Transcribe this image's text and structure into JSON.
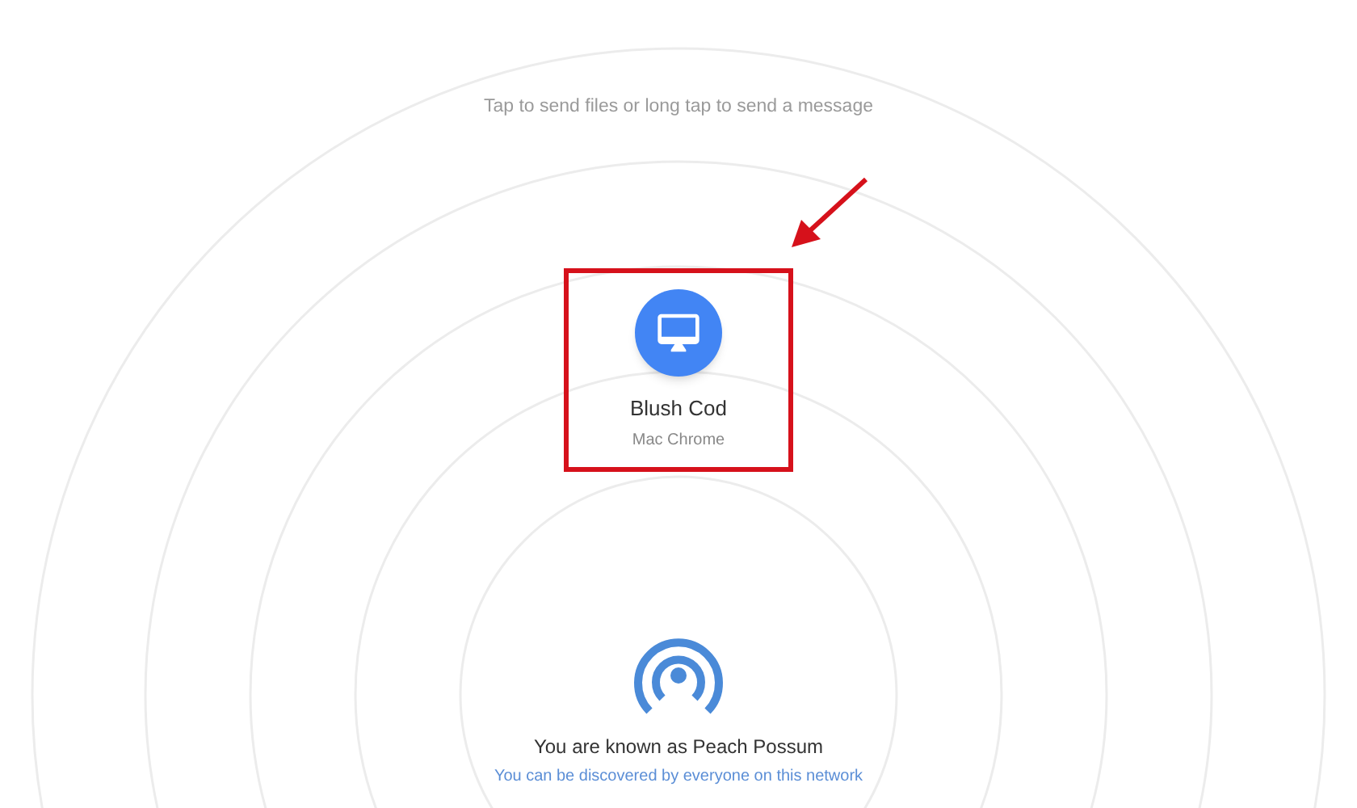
{
  "hint": "Tap to send files or long tap to send a message",
  "peers": [
    {
      "name": "Blush Cod",
      "device": "Mac Chrome",
      "highlighted": true
    }
  ],
  "footer": {
    "title": "You are known as Peach Possum",
    "subtitle": "You can be discovered by everyone on this network"
  }
}
